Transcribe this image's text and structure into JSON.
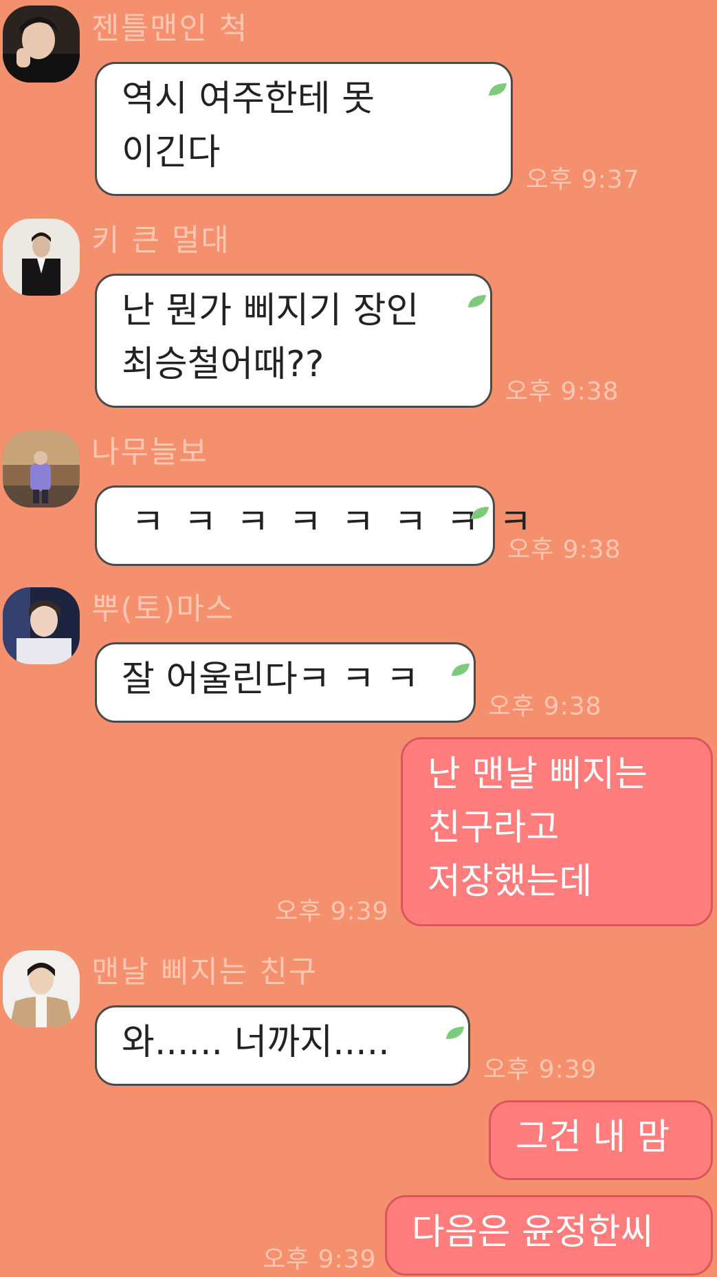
{
  "messages": [
    {
      "sender": "젠틀맨인 척",
      "lines": [
        "역시 여주한테 못",
        "이긴다"
      ],
      "time": "오후 9:37"
    },
    {
      "sender": "키 큰 멀대",
      "lines": [
        "난 뭔가 삐지기 장인",
        "최승철어때??"
      ],
      "time": "오후 9:38"
    },
    {
      "sender": "나무늘보",
      "lines": [
        "ㅋ ㅋ ㅋ ㅋ ㅋ ㅋ ㅋ ㅋ"
      ],
      "time": "오후 9:38"
    },
    {
      "sender": "뿌(토)마스",
      "lines": [
        "잘 어울린다ㅋ ㅋ ㅋ"
      ],
      "time": "오후 9:38"
    },
    {
      "sender": "",
      "lines": [
        "난 맨날 삐지는",
        "친구라고",
        "저장했는데"
      ],
      "time": "오후 9:39"
    },
    {
      "sender": "맨날 삐지는 친구",
      "lines": [
        "와...... 너까지....."
      ],
      "time": "오후 9:39"
    },
    {
      "sender": "",
      "lines": [
        "그건 내 맘"
      ],
      "time": ""
    },
    {
      "sender": "",
      "lines": [
        "다음은 윤정한씨"
      ],
      "time": "오후 9:39"
    }
  ],
  "colors": {
    "background": "#F5906E",
    "incoming_bubble": "#FFFFFF",
    "outgoing_bubble": "#FF7C7C",
    "meta_text": "#FCC7B2",
    "leaf": "#7CCB7A"
  },
  "icons": [
    "avatar-photo",
    "leaf-icon"
  ]
}
